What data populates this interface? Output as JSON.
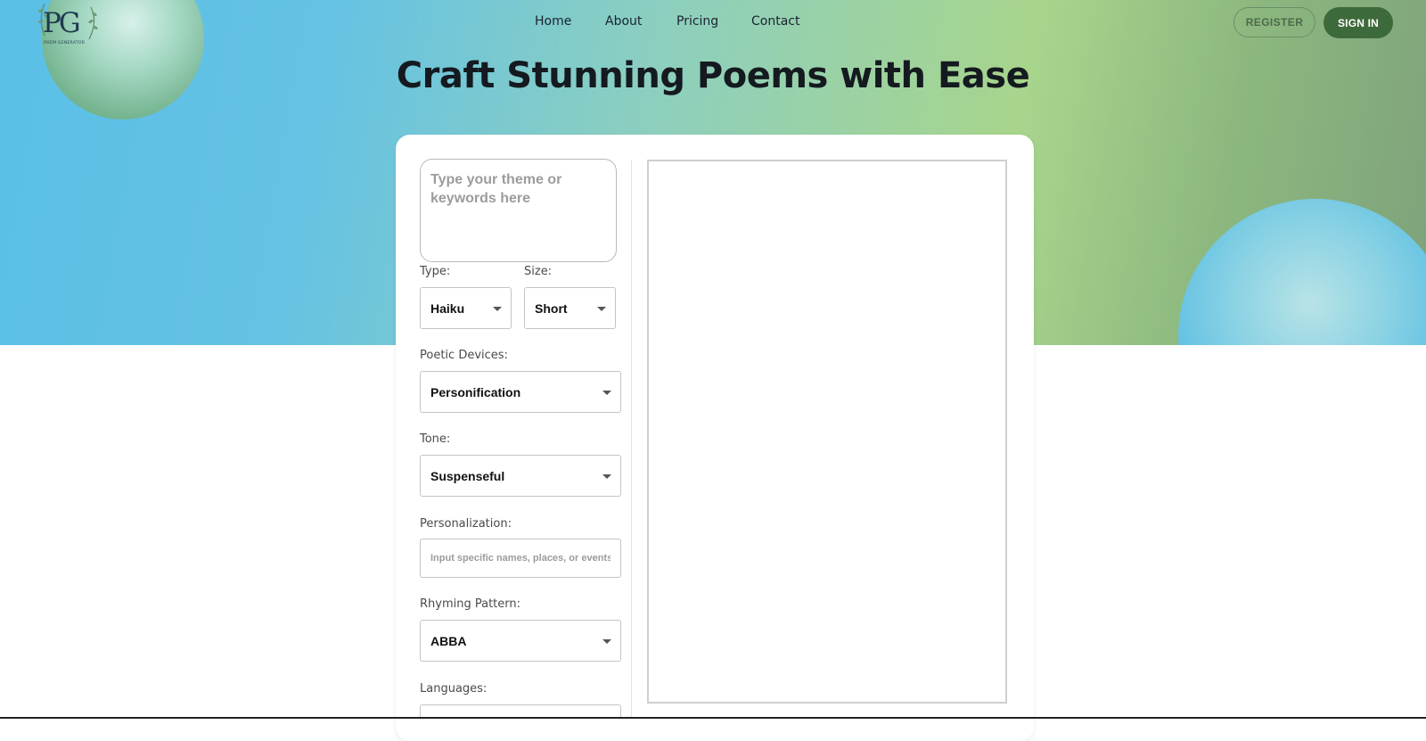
{
  "logo": {
    "mark": "PG",
    "tagline": "POEM GENERATOR"
  },
  "nav": {
    "items": [
      "Home",
      "About",
      "Pricing",
      "Contact"
    ]
  },
  "auth": {
    "register": "REGISTER",
    "sign_in": "SIGN IN"
  },
  "hero": {
    "title": "Craft Stunning Poems with Ease"
  },
  "form": {
    "theme_placeholder": "Type your theme or keywords here",
    "type": {
      "label": "Type:",
      "value": "Haiku"
    },
    "size": {
      "label": "Size:",
      "value": "Short"
    },
    "devices": {
      "label": "Poetic Devices:",
      "value": "Personification"
    },
    "tone": {
      "label": "Tone:",
      "value": "Suspenseful"
    },
    "personalization": {
      "label": "Personalization:",
      "placeholder": "Input specific names, places, or events"
    },
    "rhyming": {
      "label": "Rhyming Pattern:",
      "value": "ABBA"
    },
    "languages": {
      "label": "Languages:"
    }
  },
  "colors": {
    "accent": "#3d6a3a",
    "hero_blue": "#5bbfe6",
    "hero_green": "#a8d58c"
  }
}
